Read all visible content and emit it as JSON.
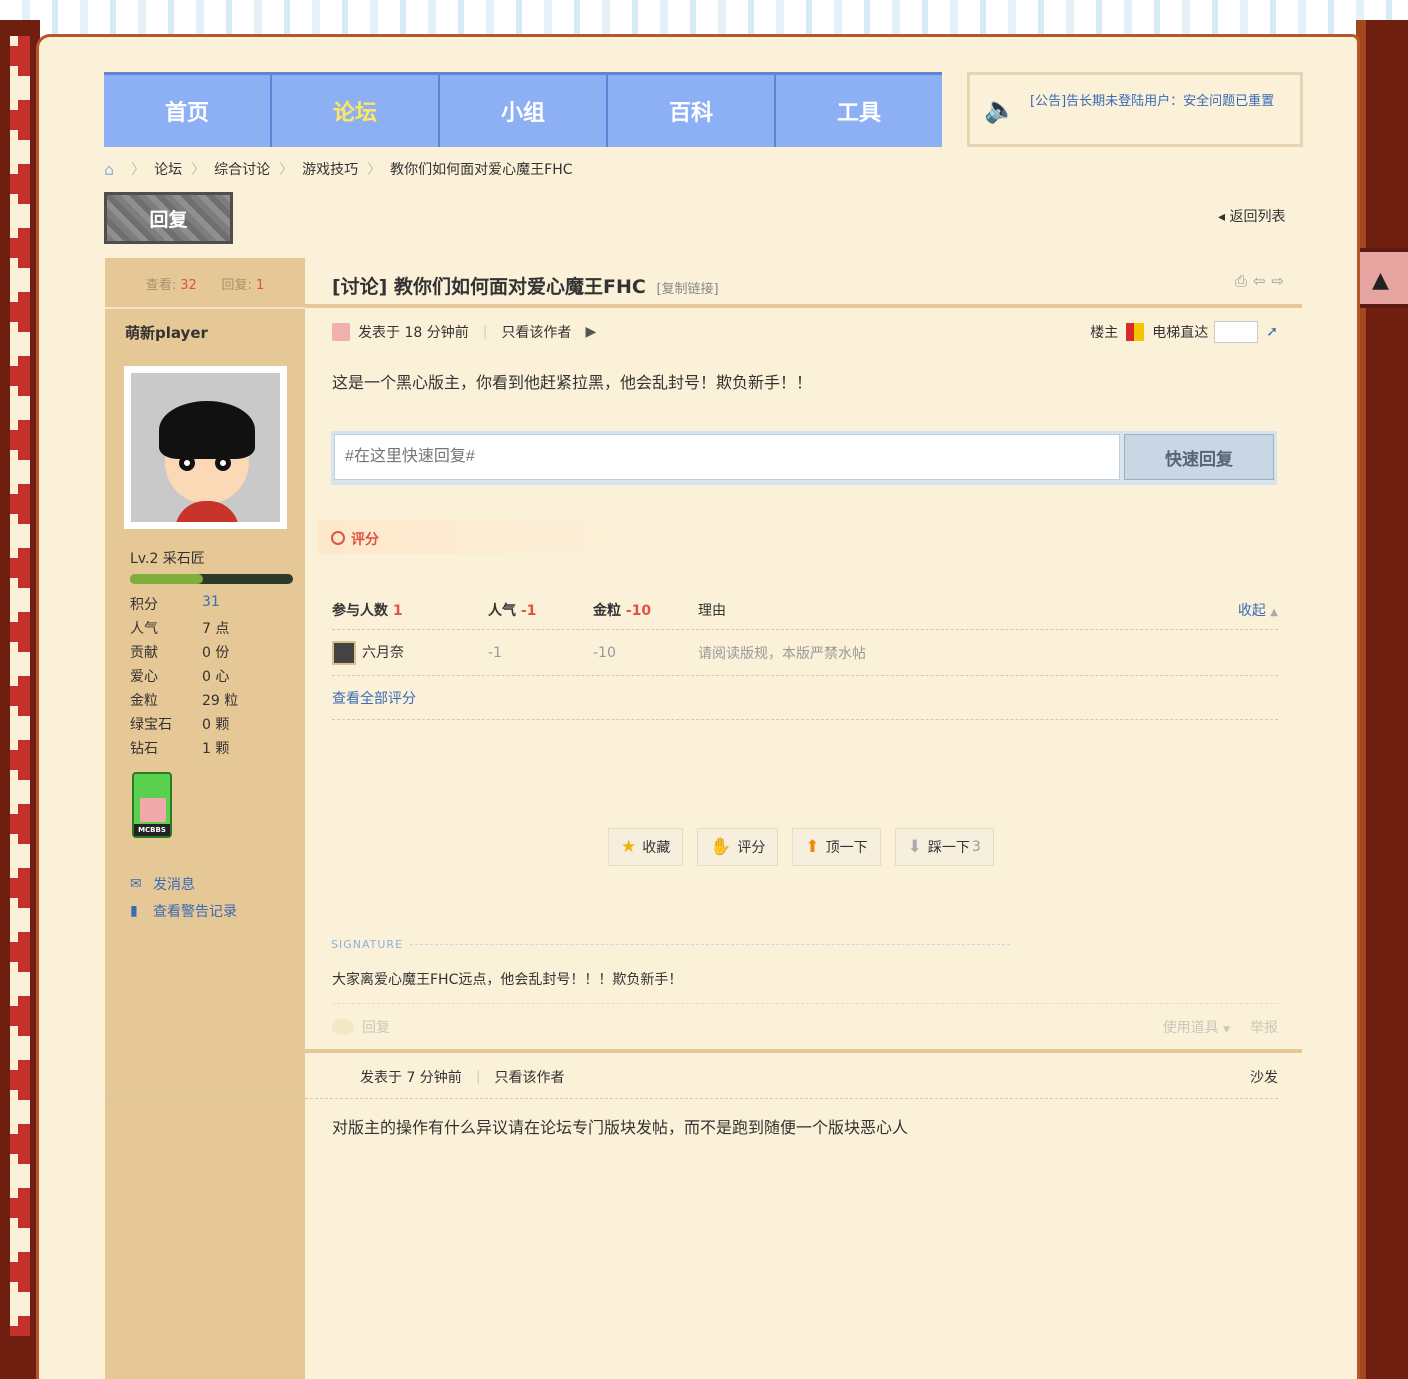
{
  "nav": {
    "items": [
      "首页",
      "论坛",
      "小组",
      "百科",
      "工具"
    ],
    "active_index": 1
  },
  "notice": {
    "text": "[公告]告长期未登陆用户：安全问题已重置"
  },
  "breadcrumb": [
    "论坛",
    "综合讨论",
    "游戏技巧",
    "教你们如何面对爱心魔王FHC"
  ],
  "reply_button": "回复",
  "back_list": "返回列表",
  "thread": {
    "views_label": "查看:",
    "views": "32",
    "replies_label": "回复:",
    "replies": "1",
    "title": "[讨论] 教你们如何面对爱心魔王FHC",
    "copy_link": "[复制链接]"
  },
  "author": {
    "name": "萌新player",
    "level": "Lv.2 采石匠",
    "level_progress": 0.45,
    "stats": [
      {
        "k": "积分",
        "v": "31"
      },
      {
        "k": "人气",
        "v": "7 点"
      },
      {
        "k": "贡献",
        "v": "0 份"
      },
      {
        "k": "爱心",
        "v": "0 心"
      },
      {
        "k": "金粒",
        "v": "29 粒"
      },
      {
        "k": "绿宝石",
        "v": "0 颗"
      },
      {
        "k": "钻石",
        "v": "1 颗"
      }
    ],
    "medal_text": "MCBBS",
    "send_message": "发消息",
    "view_warnings": "查看警告记录"
  },
  "post1": {
    "posted": "发表于 18 分钟前",
    "only_author": "只看该作者",
    "floor": "楼主",
    "elevator": "电梯直达",
    "body": "这是一个黑心版主，你看到他赶紧拉黑，他会乱封号！欺负新手！！",
    "quick_placeholder": "#在这里快速回复#",
    "quick_button": "快速回复"
  },
  "rating": {
    "tab": "评分",
    "head": {
      "participants_label": "参与人数",
      "participants": "1",
      "popularity_label": "人气",
      "popularity": "-1",
      "gold_label": "金粒",
      "gold": "-10",
      "reason_label": "理由",
      "collapse": "收起"
    },
    "rows": [
      {
        "user": "六月奈",
        "popularity": "-1",
        "gold": "-10",
        "reason": "请阅读版规，本版严禁水帖"
      }
    ],
    "view_all": "查看全部评分"
  },
  "actions": [
    {
      "icon": "star-icon",
      "label": "收藏"
    },
    {
      "icon": "thumb-icon",
      "label": "评分"
    },
    {
      "icon": "arrow-up-icon",
      "label": "顶一下"
    },
    {
      "icon": "arrow-down-icon",
      "label": "踩一下",
      "count": "3"
    }
  ],
  "signature": {
    "label": "SIGNATURE",
    "text": "大家离爱心魔王FHC远点，他会乱封号！！！欺负新手！"
  },
  "post_foot": {
    "reply": "回复",
    "use_item": "使用道具",
    "report": "举报"
  },
  "post2": {
    "posted": "发表于 7 分钟前",
    "only_author": "只看该作者",
    "floor": "沙发",
    "body": "对版主的操作有什么异议请在论坛专门版块发帖，而不是跑到随便一个版块恶心人"
  }
}
